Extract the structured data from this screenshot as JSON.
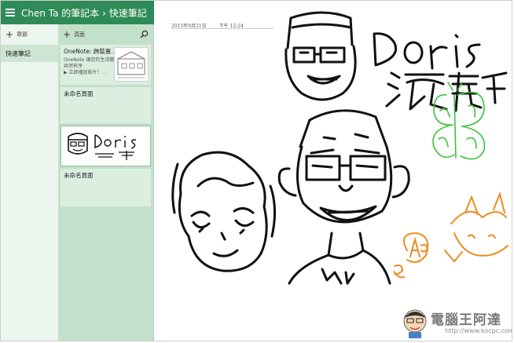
{
  "header": {
    "title": "Chen Ta 的筆記本 › 快速筆記",
    "accent": "#2e8b57"
  },
  "sections": {
    "add_label": "章節",
    "items": [
      {
        "label": "快速筆記",
        "selected": true
      }
    ]
  },
  "pages": {
    "add_label": "頁面",
    "items": [
      {
        "title": "OneNote: 跨裝置...",
        "lines": [
          "OneNote 讓您的生活變",
          "井然有序",
          "▶ 立即播放影片！..."
        ]
      },
      {
        "title": "未命名頁面",
        "lines": []
      },
      {
        "title": "",
        "lines": [],
        "selected": true
      },
      {
        "title": "未命名頁面",
        "lines": []
      }
    ]
  },
  "canvas": {
    "date": "2015年9月21日",
    "time": "下午 12:24",
    "handwriting": "Doris",
    "ink_colors": {
      "black": "#111111",
      "green": "#3cc23c",
      "orange": "#f08a1e"
    }
  },
  "watermark": {
    "name": "電腦王阿達",
    "url": "http://www.kocpc.com.tw"
  }
}
